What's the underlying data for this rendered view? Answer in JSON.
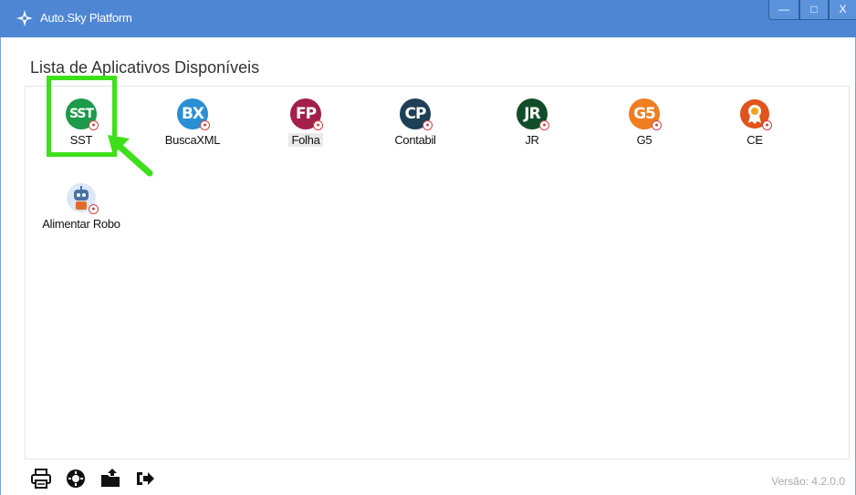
{
  "window": {
    "title": "Auto.Sky Platform",
    "controls": {
      "minimize": "—",
      "maximize": "□",
      "close": "X"
    }
  },
  "main": {
    "heading": "Lista de Aplicativos Disponíveis",
    "apps": [
      {
        "id": "sst",
        "label": "SST",
        "abbr": "SST",
        "color": "#1d9a4a",
        "selected": false
      },
      {
        "id": "buscaxml",
        "label": "BuscaXML",
        "abbr": "BX",
        "color": "#2a8fd4",
        "selected": false
      },
      {
        "id": "folha",
        "label": "Folha",
        "abbr": "FP",
        "color": "#a3204a",
        "selected": true
      },
      {
        "id": "contabil",
        "label": "Contabil",
        "abbr": "CP",
        "color": "#1e3f55",
        "selected": false
      },
      {
        "id": "jr",
        "label": "JR",
        "abbr": "JR",
        "color": "#124d2a",
        "selected": false
      },
      {
        "id": "g5",
        "label": "G5",
        "abbr": "G5",
        "color": "#ef7d22",
        "selected": false
      },
      {
        "id": "ce",
        "label": "CE",
        "abbr": "",
        "color": "#e0541c",
        "selected": false
      },
      {
        "id": "alimentar-robo",
        "label": "Alimentar Robo",
        "abbr": "",
        "color": "#cfe0f2",
        "selected": false
      }
    ]
  },
  "footer": {
    "icons": [
      "printer-icon",
      "gear-icon",
      "folder-upload-icon",
      "logout-icon"
    ],
    "version": "Versão: 4.2.0.0"
  },
  "annotation": {
    "highlight_color": "#3fe01a"
  }
}
